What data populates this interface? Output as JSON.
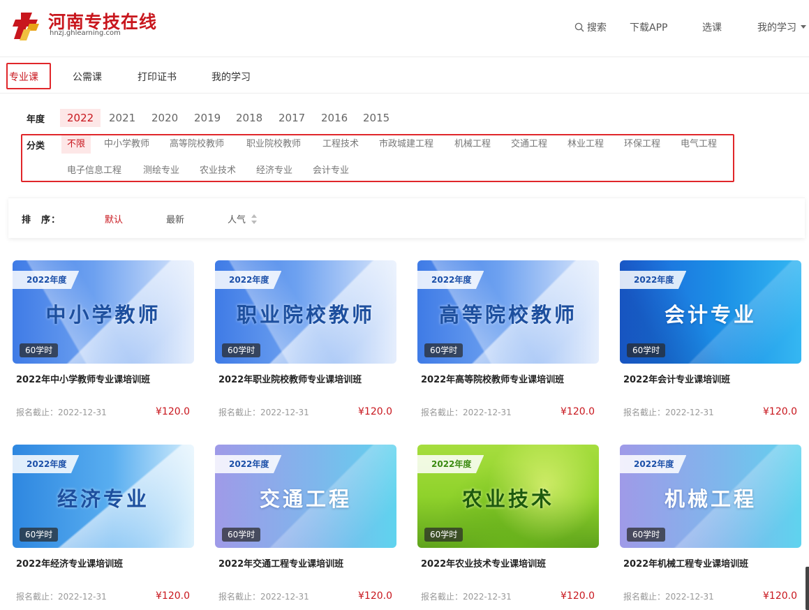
{
  "brand": {
    "title": "河南专技在线",
    "domain": "hnzj.ghlearning.com",
    "logo_color": "#c8161d"
  },
  "top_nav": {
    "search_label": "搜索",
    "download_label": "下载APP",
    "select_course_label": "选课",
    "my_study_label": "我的学习"
  },
  "tabs": [
    {
      "label": "专业课",
      "active": true
    },
    {
      "label": "公需课",
      "active": false
    },
    {
      "label": "打印证书",
      "active": false
    },
    {
      "label": "我的学习",
      "active": false
    }
  ],
  "filters": {
    "year_label": "年度",
    "years": [
      "2022",
      "2021",
      "2020",
      "2019",
      "2018",
      "2017",
      "2016",
      "2015"
    ],
    "selected_year": "2022",
    "category_label": "分类",
    "categories": [
      "不限",
      "中小学教师",
      "高等院校教师",
      "职业院校教师",
      "工程技术",
      "市政城建工程",
      "机械工程",
      "交通工程",
      "林业工程",
      "环保工程",
      "电气工程",
      "电子信息工程",
      "测绘专业",
      "农业技术",
      "经济专业",
      "会计专业"
    ],
    "selected_category": "不限"
  },
  "sort": {
    "label": "排　序：",
    "options": [
      "默认",
      "最新",
      "人气"
    ],
    "selected": "默认"
  },
  "courses": [
    {
      "badge": "2022年度",
      "thumb_title": "中小学教师",
      "hours": "60学时",
      "title": "2022年中小学教师专业课培训班",
      "deadline": "报名截止：2022-12-31",
      "price": "¥120.0",
      "theme": "light-blue"
    },
    {
      "badge": "2022年度",
      "thumb_title": "职业院校教师",
      "hours": "60学时",
      "title": "2022年职业院校教师专业课培训班",
      "deadline": "报名截止：2022-12-31",
      "price": "¥120.0",
      "theme": "light-blue"
    },
    {
      "badge": "2022年度",
      "thumb_title": "高等院校教师",
      "hours": "60学时",
      "title": "2022年高等院校教师专业课培训班",
      "deadline": "报名截止：2022-12-31",
      "price": "¥120.0",
      "theme": "light-blue"
    },
    {
      "badge": "2022年度",
      "thumb_title": "会计专业",
      "hours": "60学时",
      "title": "2022年会计专业课培训班",
      "deadline": "报名截止：2022-12-31",
      "price": "¥120.0",
      "theme": "deep-blue"
    },
    {
      "badge": "2022年度",
      "thumb_title": "经济专业",
      "hours": "60学时",
      "title": "2022年经济专业课培训班",
      "deadline": "报名截止：2022-12-31",
      "price": "¥120.0",
      "theme": "sky"
    },
    {
      "badge": "2022年度",
      "thumb_title": "交通工程",
      "hours": "60学时",
      "title": "2022年交通工程专业课培训班",
      "deadline": "报名截止：2022-12-31",
      "price": "¥120.0",
      "theme": "purple-cyan"
    },
    {
      "badge": "2022年度",
      "thumb_title": "农业技术",
      "hours": "60学时",
      "title": "2022年农业技术专业课培训班",
      "deadline": "报名截止：2022-12-31",
      "price": "¥120.0",
      "theme": "green"
    },
    {
      "badge": "2022年度",
      "thumb_title": "机械工程",
      "hours": "60学时",
      "title": "2022年机械工程专业课培训班",
      "deadline": "报名截止：2022-12-31",
      "price": "¥120.0",
      "theme": "purple-cyan"
    }
  ],
  "colors": {
    "accent": "#c8161d",
    "highlight_box": "#e0262a",
    "selected_bg": "#fde7e7"
  }
}
